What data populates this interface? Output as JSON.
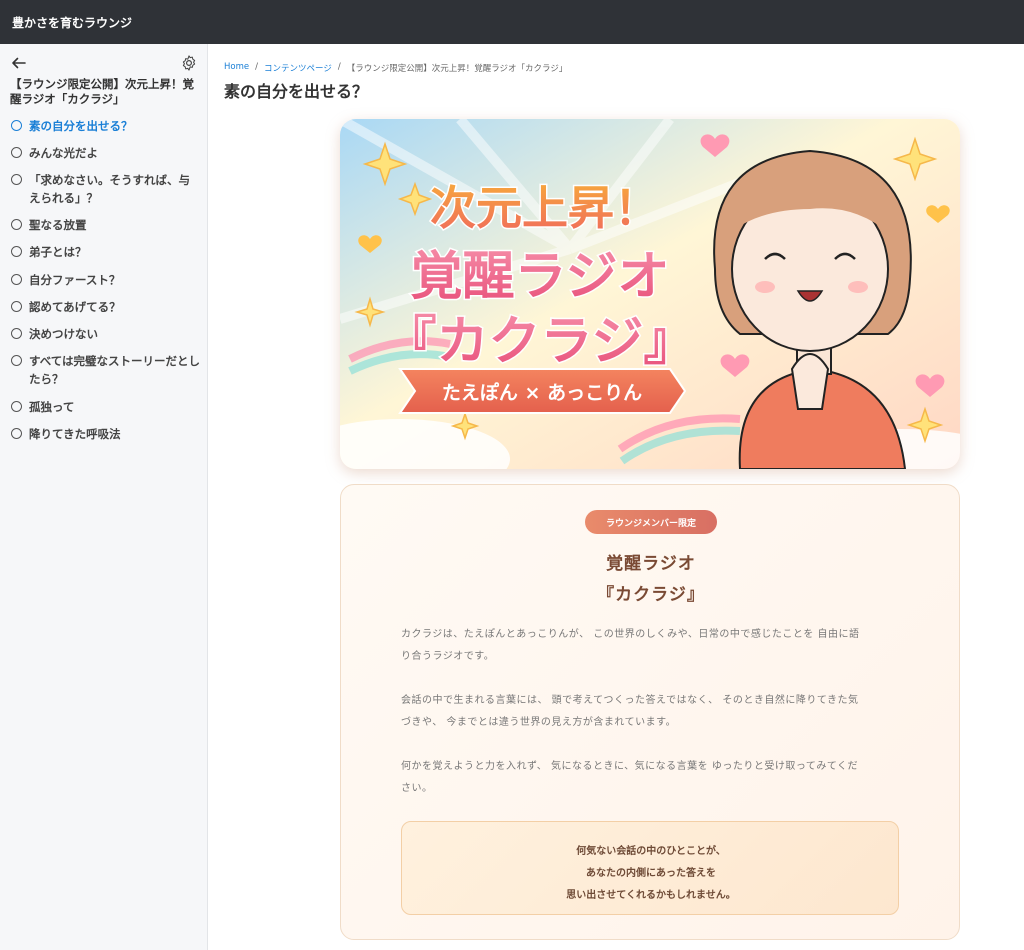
{
  "app": {
    "title": "豊かさを育むラウンジ"
  },
  "sidebar": {
    "course_title": "【ラウンジ限定公開】次元上昇！覚醒ラジオ「カクラジ」",
    "lessons": [
      {
        "label": "素の自分を出せる？",
        "active": true
      },
      {
        "label": "みんな光だよ",
        "active": false
      },
      {
        "label": "「求めなさい。そうすれば、与えられる」？",
        "active": false
      },
      {
        "label": "聖なる放置",
        "active": false
      },
      {
        "label": "弟子とは？",
        "active": false
      },
      {
        "label": "自分ファースト？",
        "active": false
      },
      {
        "label": "認めてあげてる？",
        "active": false
      },
      {
        "label": "決めつけない",
        "active": false
      },
      {
        "label": "すべては完璧なストーリーだとしたら？",
        "active": false
      },
      {
        "label": "孤独って",
        "active": false
      },
      {
        "label": "降りてきた呼吸法",
        "active": false
      }
    ]
  },
  "breadcrumb": {
    "items": [
      "Home",
      "コンテンツページ",
      "【ラウンジ限定公開】次元上昇！覚醒ラジオ「カクラジ」"
    ],
    "separator": "/"
  },
  "page": {
    "title": "素の自分を出せる？"
  },
  "hero": {
    "line1": "次元上昇！",
    "line2": "覚醒ラジオ",
    "line3": "『カクラジ』",
    "ribbon": "たえぽん × あっこりん"
  },
  "card": {
    "badge": "ラウンジメンバー限定",
    "title_line1": "覚醒ラジオ",
    "title_line2": "『カクラジ』",
    "paragraphs": [
      [
        "カクラジは、たえぽんとあっこりんが、 この世界のしくみや、日常の中で感じたことを 自由に語",
        "り合うラジオです。"
      ],
      [
        "会話の中で生まれる言葉には、 頭で考えてつくった答えではなく、 そのとき自然に降りてきた気",
        "づきや、 今までとは違う世界の見え方が含まれています。"
      ],
      [
        "何かを覚えようと力を入れず、 気になるときに、気になる言葉を ゆったりと受け取ってみてくだ",
        "さい。"
      ]
    ],
    "quote": [
      "何気ない会話の中のひとことが、",
      "あなたの内側にあった答えを",
      "思い出させてくれるかもしれません。"
    ]
  },
  "colors": {
    "accent": "#1a7fd6",
    "topbar": "#2f3237",
    "badge": "#e07b66"
  }
}
